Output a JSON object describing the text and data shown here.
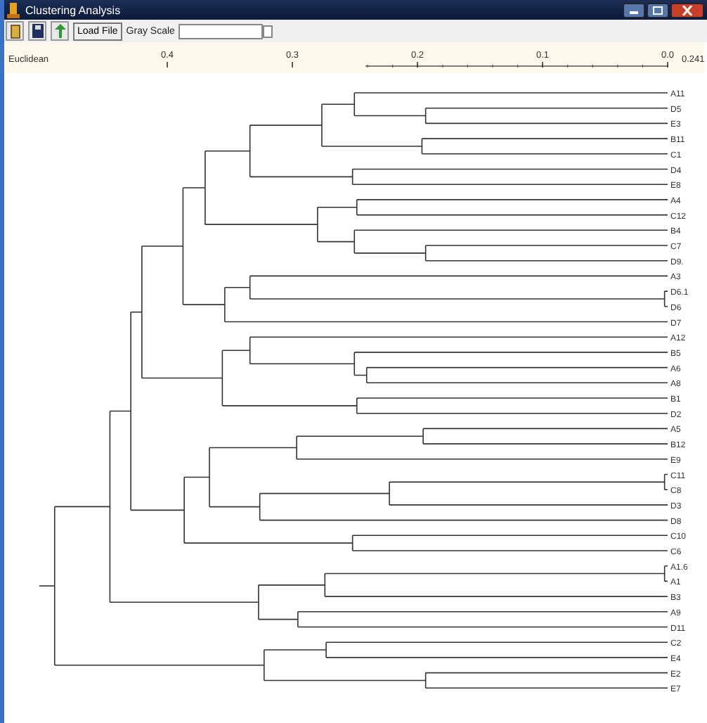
{
  "window": {
    "title": "Clustering Analysis"
  },
  "toolbar": {
    "load_button": "Load File",
    "gray_scale_label": "Gray Scale"
  },
  "axis": {
    "name": "Euclidean",
    "right_label": "0.241",
    "ticks": [
      "0.4",
      "0.3",
      "0.2",
      "0.1",
      "0.0"
    ]
  },
  "dendrogram": {
    "tree": {
      "children": [
        {
          "children": [
            {
              "children": [
                {
                  "children": [
                    {
                      "children": [
                        {
                          "children": [
                            {
                              "children": [
                                {
                                  "children": [
                                    {
                                      "children": [
                                        {
                                          "label": "A11"
                                        },
                                        {
                                          "children": [
                                            {
                                              "label": "D5"
                                            },
                                            {
                                              "label": "E3"
                                            }
                                          ]
                                        }
                                      ]
                                    },
                                    {
                                      "children": [
                                        {
                                          "label": "B11"
                                        },
                                        {
                                          "label": "C1"
                                        }
                                      ]
                                    }
                                  ]
                                },
                                {
                                  "children": [
                                    {
                                      "label": "D4"
                                    },
                                    {
                                      "label": "E8"
                                    }
                                  ]
                                }
                              ]
                            },
                            {
                              "children": [
                                {
                                  "children": [
                                    {
                                      "label": "A4"
                                    },
                                    {
                                      "label": "C12"
                                    }
                                  ]
                                },
                                {
                                  "children": [
                                    {
                                      "label": "B4"
                                    },
                                    {
                                      "children": [
                                        {
                                          "label": "C7"
                                        },
                                        {
                                          "label": "D9."
                                        }
                                      ]
                                    }
                                  ]
                                }
                              ]
                            }
                          ]
                        },
                        {
                          "children": [
                            {
                              "children": [
                                {
                                  "label": "A3"
                                },
                                {
                                  "children": [
                                    {
                                      "label": "D6.1"
                                    },
                                    {
                                      "label": "D6"
                                    }
                                  ]
                                }
                              ]
                            },
                            {
                              "label": "D7"
                            }
                          ]
                        }
                      ]
                    },
                    {
                      "children": [
                        {
                          "children": [
                            {
                              "label": "A12"
                            },
                            {
                              "children": [
                                {
                                  "label": "B5"
                                },
                                {
                                  "children": [
                                    {
                                      "label": "A6"
                                    },
                                    {
                                      "label": "A8"
                                    }
                                  ]
                                }
                              ]
                            }
                          ]
                        },
                        {
                          "children": [
                            {
                              "label": "B1"
                            },
                            {
                              "label": "D2"
                            }
                          ]
                        }
                      ]
                    }
                  ]
                },
                {
                  "children": [
                    {
                      "children": [
                        {
                          "children": [
                            {
                              "children": [
                                {
                                  "label": "A5"
                                },
                                {
                                  "label": "B12"
                                }
                              ]
                            },
                            {
                              "label": "E9"
                            }
                          ]
                        },
                        {
                          "children": [
                            {
                              "children": [
                                {
                                  "children": [
                                    {
                                      "label": "C11"
                                    },
                                    {
                                      "label": "C8"
                                    }
                                  ]
                                },
                                {
                                  "label": "D3"
                                }
                              ]
                            },
                            {
                              "label": "D8"
                            }
                          ]
                        }
                      ]
                    },
                    {
                      "children": [
                        {
                          "label": "C10"
                        },
                        {
                          "label": "C6"
                        }
                      ]
                    }
                  ]
                }
              ]
            },
            {
              "children": [
                {
                  "children": [
                    {
                      "children": [
                        {
                          "label": "A1.6"
                        },
                        {
                          "label": "A1"
                        }
                      ]
                    },
                    {
                      "label": "B3"
                    }
                  ]
                },
                {
                  "children": [
                    {
                      "label": "A9"
                    },
                    {
                      "label": "D11"
                    }
                  ]
                }
              ]
            }
          ]
        },
        {
          "children": [
            {
              "children": [
                {
                  "label": "C2"
                },
                {
                  "label": "E4"
                }
              ]
            },
            {
              "children": [
                {
                  "label": "E2"
                },
                {
                  "label": "E7"
                }
              ]
            }
          ]
        }
      ]
    }
  }
}
